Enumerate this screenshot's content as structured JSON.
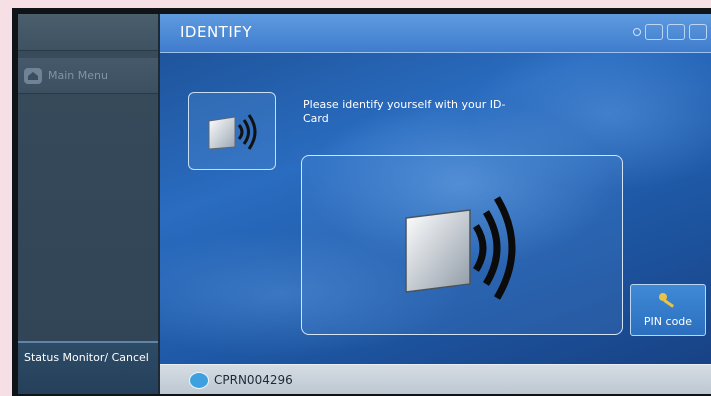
{
  "sidebar": {
    "main_menu_label": "Main Menu",
    "status_button_label": "Status Monitor/ Cancel"
  },
  "header": {
    "title": "IDENTIFY"
  },
  "content": {
    "instruction": "Please identify yourself with your ID-Card",
    "pin_button_label": "PIN code"
  },
  "statusbar": {
    "device_id": "CPRN004296"
  },
  "icons": {
    "main_menu": "home-icon",
    "card_reader": "id-card-contactless-icon",
    "pin": "key-icon",
    "status": "printer-status-icon"
  },
  "colors": {
    "accent": "#3f7ccc",
    "sidebar": "#34485a",
    "statusbar": "#c9d2da"
  }
}
